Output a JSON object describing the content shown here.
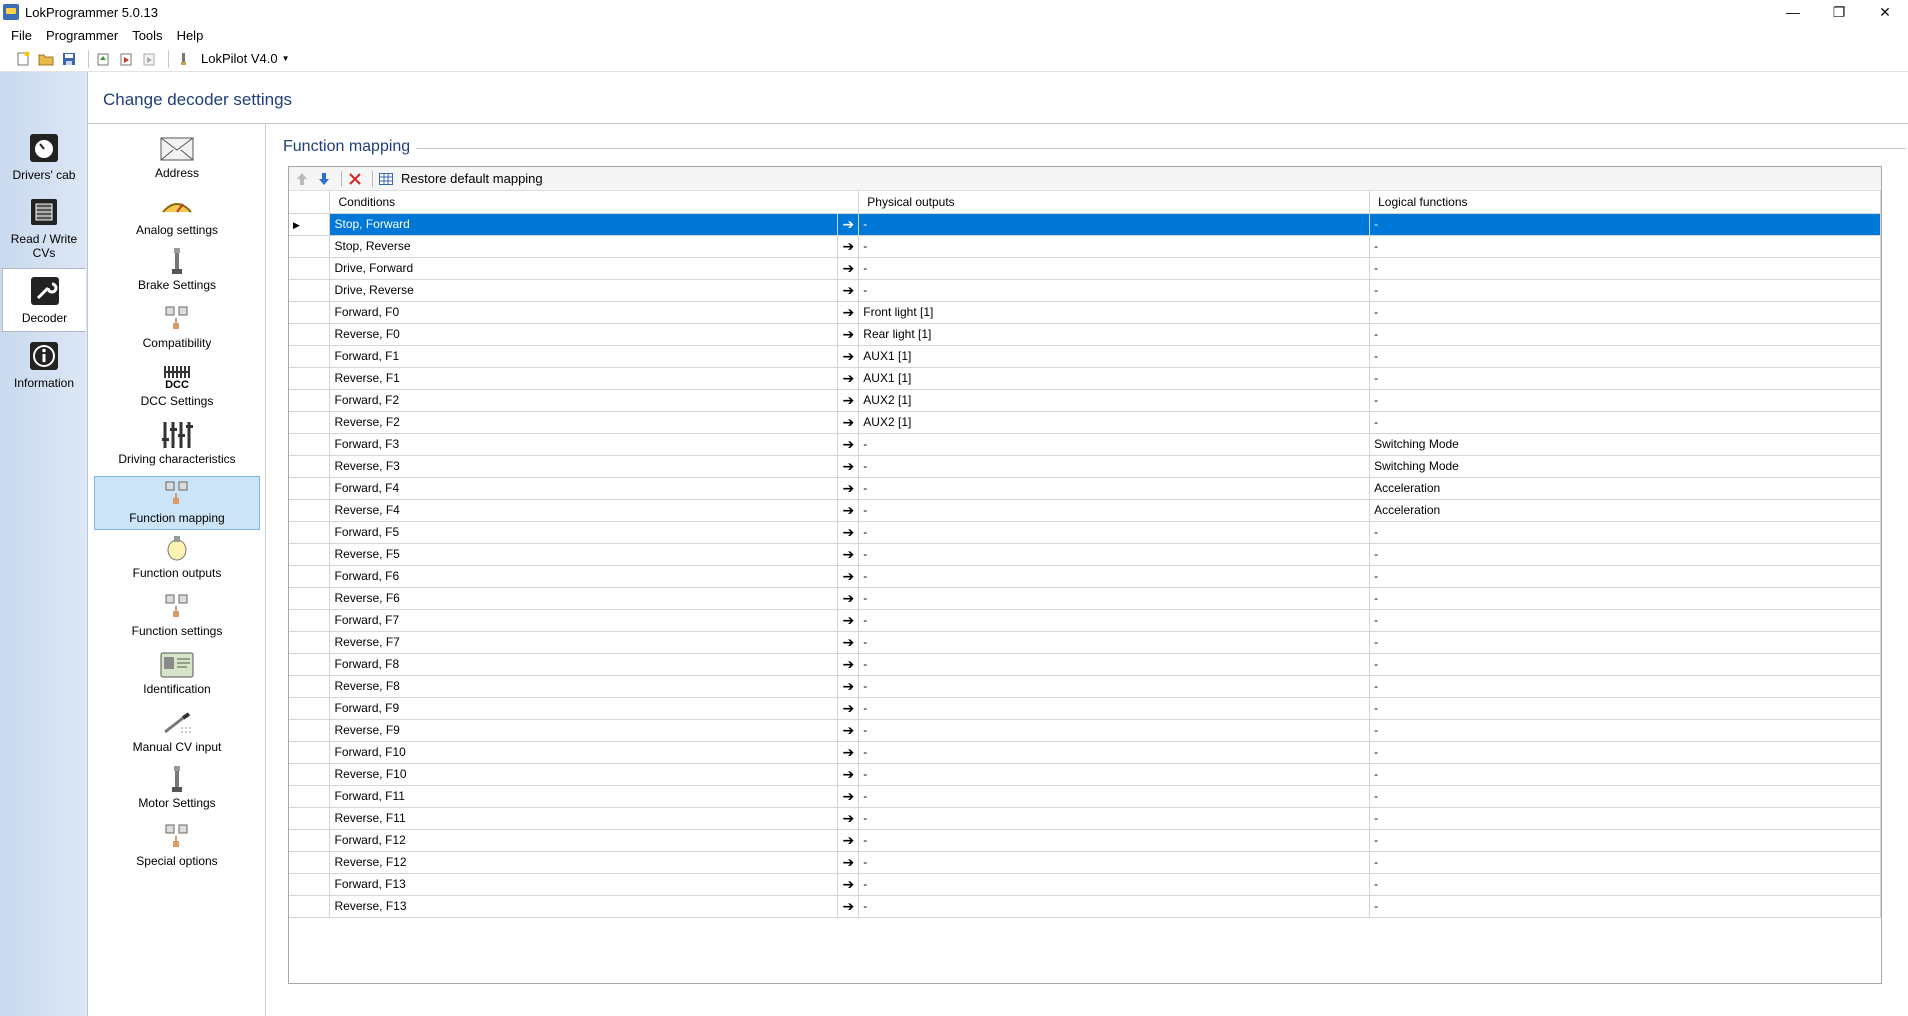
{
  "window": {
    "title": "LokProgrammer 5.0.13",
    "controls": {
      "minimize": "—",
      "restore": "❐",
      "close": "✕"
    }
  },
  "menu": [
    "File",
    "Programmer",
    "Tools",
    "Help"
  ],
  "toolbar": {
    "decoder_label": "LokPilot V4.0"
  },
  "leftbar": {
    "items": [
      {
        "label": "Drivers' cab",
        "icon": "clock-icon"
      },
      {
        "label": "Read / Write CVs",
        "icon": "chip-icon"
      },
      {
        "label": "Decoder",
        "icon": "wrench-icon",
        "selected": true
      },
      {
        "label": "Information",
        "icon": "info-icon"
      }
    ]
  },
  "section": {
    "title": "Change decoder settings"
  },
  "categories": [
    {
      "label": "Address"
    },
    {
      "label": "Analog settings"
    },
    {
      "label": "Brake Settings"
    },
    {
      "label": "Compatibility"
    },
    {
      "label": "DCC Settings",
      "icon_text": "DCC"
    },
    {
      "label": "Driving characteristics"
    },
    {
      "label": "Function mapping",
      "selected": true
    },
    {
      "label": "Function outputs"
    },
    {
      "label": "Function settings"
    },
    {
      "label": "Identification"
    },
    {
      "label": "Manual CV input"
    },
    {
      "label": "Motor Settings"
    },
    {
      "label": "Special options"
    }
  ],
  "group": {
    "title": "Function mapping",
    "toolbar": {
      "restore_label": "Restore default mapping"
    },
    "columns": {
      "conditions": "Conditions",
      "physical": "Physical outputs",
      "logical": "Logical functions"
    },
    "rows": [
      {
        "condition": "Stop, Forward",
        "physical": "-",
        "logical": "-",
        "selected": true
      },
      {
        "condition": "Stop, Reverse",
        "physical": "-",
        "logical": "-"
      },
      {
        "condition": "Drive, Forward",
        "physical": "-",
        "logical": "-"
      },
      {
        "condition": "Drive, Reverse",
        "physical": "-",
        "logical": "-"
      },
      {
        "condition": "Forward, F0",
        "physical": "Front light [1]",
        "logical": "-"
      },
      {
        "condition": "Reverse, F0",
        "physical": "Rear light [1]",
        "logical": "-"
      },
      {
        "condition": "Forward, F1",
        "physical": "AUX1 [1]",
        "logical": "-"
      },
      {
        "condition": "Reverse, F1",
        "physical": "AUX1 [1]",
        "logical": "-"
      },
      {
        "condition": "Forward, F2",
        "physical": "AUX2 [1]",
        "logical": "-"
      },
      {
        "condition": "Reverse, F2",
        "physical": "AUX2 [1]",
        "logical": "-"
      },
      {
        "condition": "Forward, F3",
        "physical": "-",
        "logical": "Switching Mode"
      },
      {
        "condition": "Reverse, F3",
        "physical": "-",
        "logical": "Switching Mode"
      },
      {
        "condition": "Forward, F4",
        "physical": "-",
        "logical": "Acceleration"
      },
      {
        "condition": "Reverse, F4",
        "physical": "-",
        "logical": "Acceleration"
      },
      {
        "condition": "Forward, F5",
        "physical": "-",
        "logical": "-"
      },
      {
        "condition": "Reverse, F5",
        "physical": "-",
        "logical": "-"
      },
      {
        "condition": "Forward, F6",
        "physical": "-",
        "logical": "-"
      },
      {
        "condition": "Reverse, F6",
        "physical": "-",
        "logical": "-"
      },
      {
        "condition": "Forward, F7",
        "physical": "-",
        "logical": "-"
      },
      {
        "condition": "Reverse, F7",
        "physical": "-",
        "logical": "-"
      },
      {
        "condition": "Forward, F8",
        "physical": "-",
        "logical": "-"
      },
      {
        "condition": "Reverse, F8",
        "physical": "-",
        "logical": "-"
      },
      {
        "condition": "Forward, F9",
        "physical": "-",
        "logical": "-"
      },
      {
        "condition": "Reverse, F9",
        "physical": "-",
        "logical": "-"
      },
      {
        "condition": "Forward, F10",
        "physical": "-",
        "logical": "-"
      },
      {
        "condition": "Reverse, F10",
        "physical": "-",
        "logical": "-"
      },
      {
        "condition": "Forward, F11",
        "physical": "-",
        "logical": "-"
      },
      {
        "condition": "Reverse, F11",
        "physical": "-",
        "logical": "-"
      },
      {
        "condition": "Forward, F12",
        "physical": "-",
        "logical": "-"
      },
      {
        "condition": "Reverse, F12",
        "physical": "-",
        "logical": "-"
      },
      {
        "condition": "Forward, F13",
        "physical": "-",
        "logical": "-"
      },
      {
        "condition": "Reverse, F13",
        "physical": "-",
        "logical": "-"
      }
    ]
  }
}
